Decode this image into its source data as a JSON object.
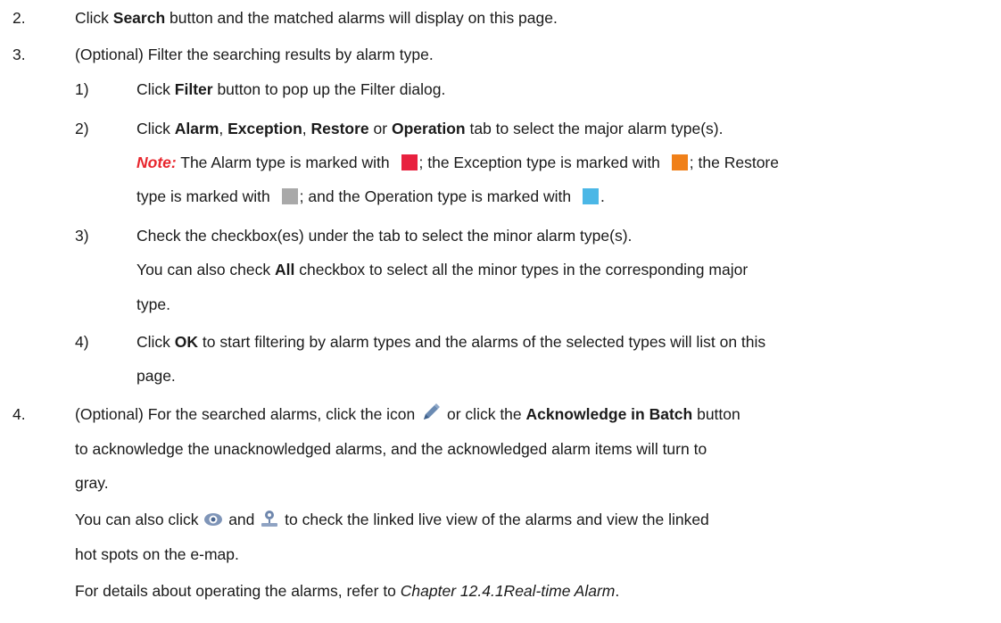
{
  "steps": {
    "s2": {
      "num": "2.",
      "pre": "Click ",
      "b1": "Search",
      "post": " button and the matched alarms will display on this page."
    },
    "s3": {
      "num": "3.",
      "text": "(Optional) Filter the searching results by alarm type."
    },
    "s3_1": {
      "num": "1)",
      "pre": "Click ",
      "b1": "Filter",
      "post": " button to pop up the Filter dialog."
    },
    "s3_2": {
      "num": "2)",
      "pre": "Click ",
      "b1": "Alarm",
      "t1": ", ",
      "b2": "Exception",
      "t2": ", ",
      "b3": "Restore",
      "t3": " or ",
      "b4": "Operation",
      "post": " tab to select the major alarm type(s).",
      "note_label": "Note:",
      "n1": " The Alarm type is marked with ",
      "n2": "; the Exception type is marked with ",
      "n3": "; the Restore",
      "n4": "type is marked with ",
      "n5": "; and the Operation type is marked with ",
      "n6": "."
    },
    "s3_3": {
      "num": "3)",
      "text": "Check the checkbox(es) under the tab to select the minor alarm type(s).",
      "pre2": "You can also check ",
      "b1": "All",
      "post2": " checkbox to select all the minor types in the corresponding major",
      "tail": "type."
    },
    "s3_4": {
      "num": "4)",
      "pre": "Click ",
      "b1": "OK",
      "post": " to start filtering by alarm types and the alarms of the selected types will list on this",
      "tail": "page."
    },
    "s4": {
      "num": "4.",
      "pre": "(Optional) For the searched alarms, click the icon ",
      "mid": " or click the ",
      "b1": "Acknowledge in Batch",
      "post": " button",
      "l2": "to acknowledge the unacknowledged alarms, and the acknowledged alarm items will turn to",
      "l3": "gray.",
      "l4a": "You can also click ",
      "l4b": " and ",
      "l4c": " to check the linked live view of the alarms and view the linked",
      "l5": "hot spots on the e-map.",
      "l6a": "For details about operating the alarms, refer to ",
      "l6b": "Chapter 12.4.1Real-time Alarm",
      "l6c": "."
    }
  },
  "colors": {
    "alarm": "#e8213f",
    "exception": "#f08019",
    "restore": "#a9a9a9",
    "operation": "#4bb7e6",
    "note": "#e8262d"
  },
  "icons": [
    "pencil-icon",
    "eye-icon",
    "map-pin-icon"
  ]
}
